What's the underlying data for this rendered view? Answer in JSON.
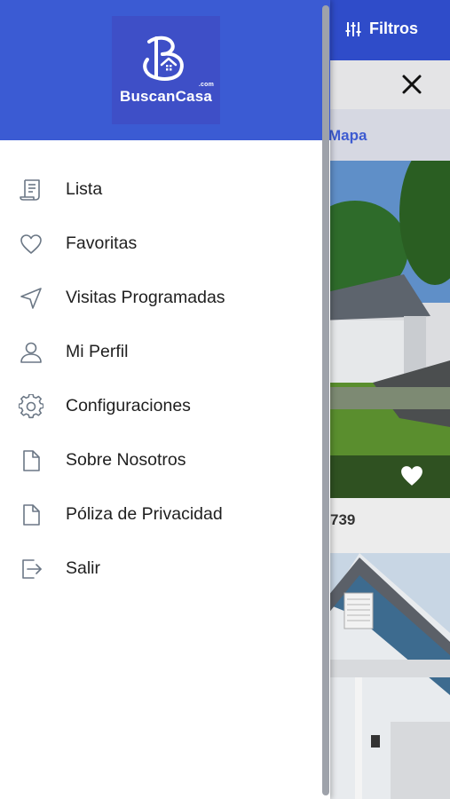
{
  "header": {
    "filters_label": "Filtros",
    "map_label": "Mapa",
    "listing_price_partial": "739"
  },
  "drawer": {
    "logo_text": "BuscanCasa",
    "logo_suffix": ".com",
    "menu": [
      {
        "label": "Lista",
        "icon": "list-document-icon"
      },
      {
        "label": "Favoritas",
        "icon": "heart-icon"
      },
      {
        "label": "Visitas Programadas",
        "icon": "navigation-arrow-icon"
      },
      {
        "label": "Mi Perfil",
        "icon": "user-icon"
      },
      {
        "label": "Configuraciones",
        "icon": "gear-icon"
      },
      {
        "label": "Sobre Nosotros",
        "icon": "document-icon"
      },
      {
        "label": "Póliza de Privacidad",
        "icon": "document-icon"
      },
      {
        "label": "Salir",
        "icon": "logout-icon"
      }
    ]
  },
  "colors": {
    "brand_blue": "#3b5bd3",
    "header_blue": "#2f4cc9",
    "icon_gray": "#6b7785"
  }
}
